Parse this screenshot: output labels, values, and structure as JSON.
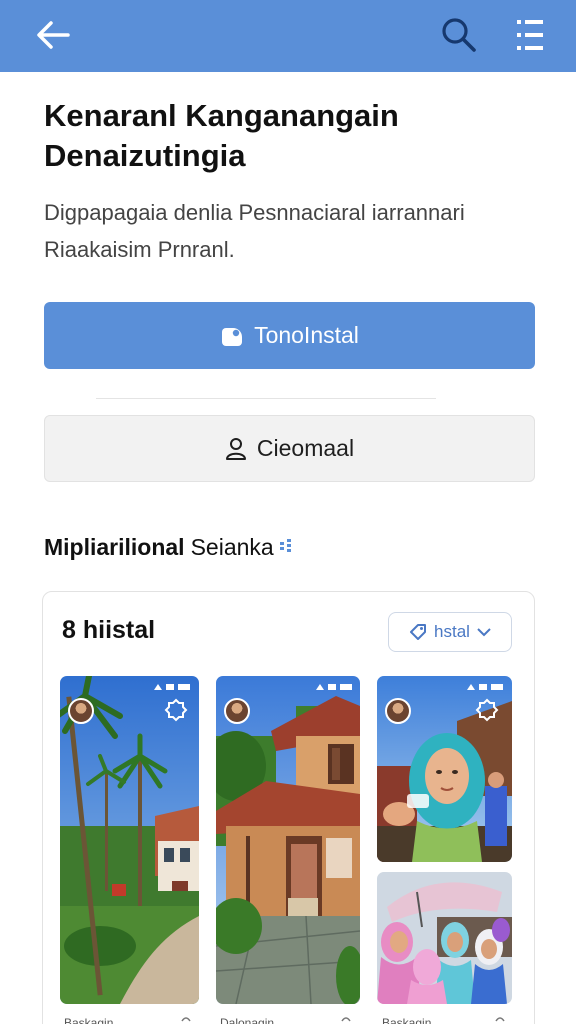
{
  "appbar": {
    "back_icon": "arrow-left-icon",
    "search_icon": "search-icon",
    "menu_icon": "menu-icon",
    "color": "#5a8fd8"
  },
  "header": {
    "title_line1": "Kenaranl Kanganangain",
    "title_line2": "Denaizutingia",
    "subtitle_line1": "Digpapagaia denlia Pesnnaciaral iarrannari",
    "subtitle_line2": "Riaakaisim Prnranl."
  },
  "actions": {
    "primary_label": "TonoInstal",
    "primary_icon": "app-icon",
    "secondary_label": "Cieomaal",
    "secondary_icon": "user-icon"
  },
  "section": {
    "heading_bold": "Mipliarilional",
    "heading_rest": "Seianka"
  },
  "card": {
    "title": "8 hiistal",
    "chip_label": "hstal",
    "chip_icon": "tag-icon",
    "chip_dropdown_icon": "chevron-down-icon"
  },
  "captions": [
    {
      "label": "Baskagin"
    },
    {
      "label": "Dalonagin"
    },
    {
      "label": "Baskagin"
    }
  ],
  "colors": {
    "accent": "#5a8fd8",
    "text": "#111111",
    "muted": "#444444"
  }
}
